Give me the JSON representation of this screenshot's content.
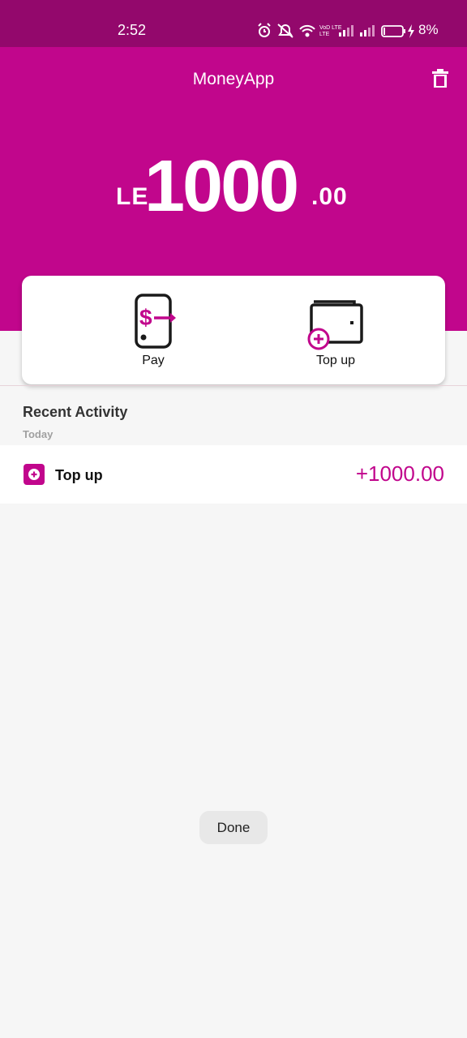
{
  "status_bar": {
    "time": "2:52",
    "icons": [
      "alarm-icon",
      "mute-icon",
      "wifi-icon",
      "volte-icon",
      "signal-icon",
      "signal-icon",
      "battery-icon",
      "charging-icon"
    ],
    "network_label": "VoD LTE",
    "battery_percent": "8%"
  },
  "header": {
    "title": "MoneyApp",
    "delete_icon": "trash-icon",
    "color": "#c1068c"
  },
  "balance": {
    "currency": "LE",
    "amount": "1000",
    "cents": ".00"
  },
  "actions": [
    {
      "label": "Pay",
      "icon": "phone-dollar-icon"
    },
    {
      "label": "Top up",
      "icon": "wallet-plus-icon"
    }
  ],
  "recent": {
    "title": "Recent Activity",
    "subtitle": "Today",
    "items": [
      {
        "label": "Top up",
        "amount": "+1000.00",
        "icon": "plus-square-icon"
      }
    ]
  },
  "done_label": "Done",
  "colors": {
    "accent": "#c1068c",
    "status_bar": "#93086c"
  }
}
